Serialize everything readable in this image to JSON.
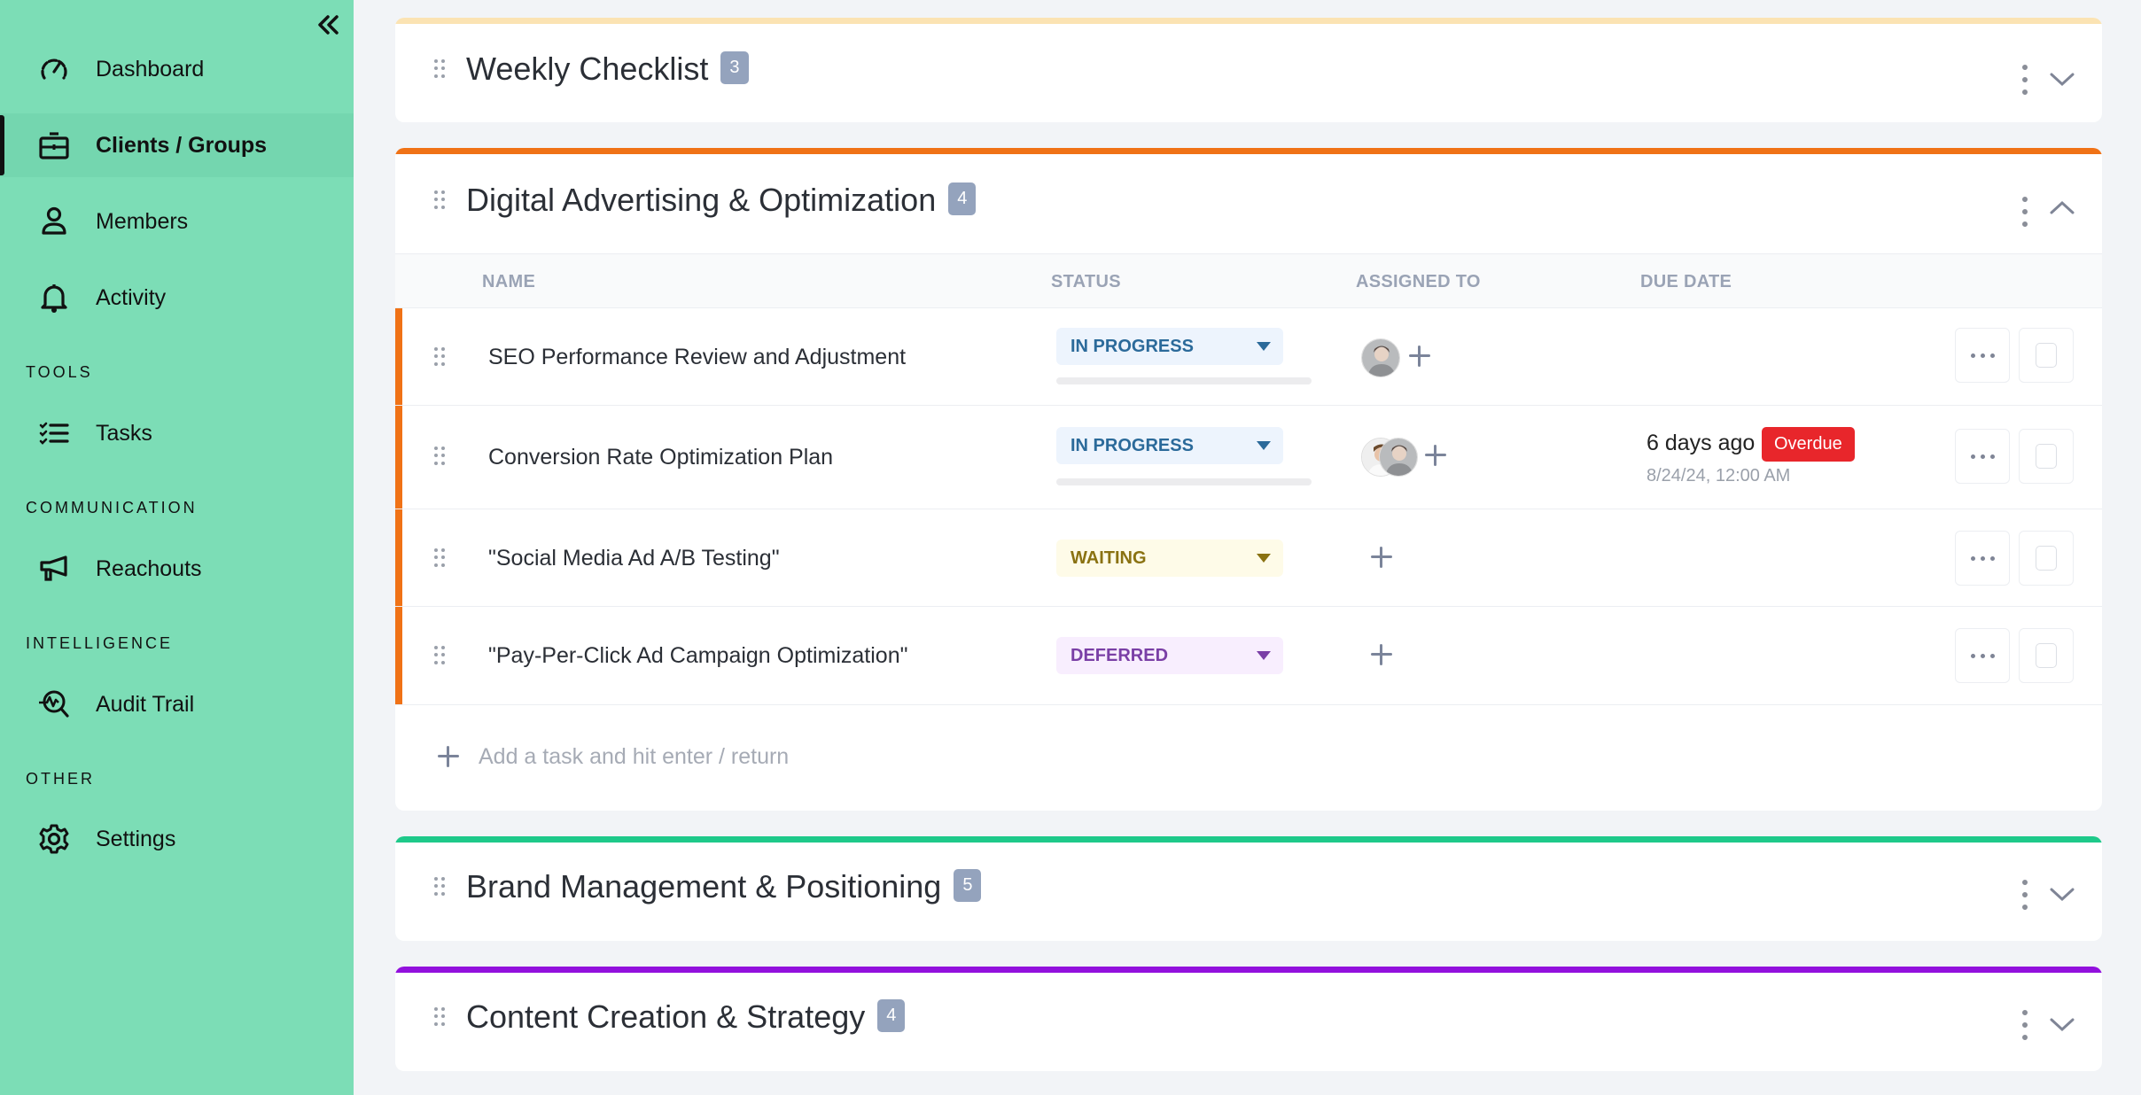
{
  "sidebar": {
    "collapse_label": "Collapse sidebar",
    "items": [
      {
        "label": "Dashboard",
        "icon": "dashboard-gauge-icon",
        "active": false
      },
      {
        "label": "Clients / Groups",
        "icon": "briefcase-icon",
        "active": true
      },
      {
        "label": "Members",
        "icon": "person-icon",
        "active": false
      },
      {
        "label": "Activity",
        "icon": "bell-icon",
        "active": false
      }
    ],
    "sections": [
      {
        "title": "TOOLS",
        "items": [
          {
            "label": "Tasks",
            "icon": "checklist-icon"
          }
        ]
      },
      {
        "title": "COMMUNICATION",
        "items": [
          {
            "label": "Reachouts",
            "icon": "megaphone-icon"
          }
        ]
      },
      {
        "title": "INTELLIGENCE",
        "items": [
          {
            "label": "Audit Trail",
            "icon": "search-activity-icon"
          }
        ]
      },
      {
        "title": "OTHER",
        "items": [
          {
            "label": "Settings",
            "icon": "gear-icon"
          }
        ]
      }
    ]
  },
  "groups": [
    {
      "title": "Weekly Checklist",
      "count": "3",
      "color": "#fbe3b3",
      "expanded": false
    },
    {
      "title": "Digital Advertising & Optimization",
      "count": "4",
      "color": "#f07216",
      "expanded": true,
      "columns": {
        "name": "NAME",
        "status": "STATUS",
        "assigned": "ASSIGNED TO",
        "due": "DUE DATE"
      },
      "tasks": [
        {
          "name": "SEO Performance Review and Adjustment",
          "status": "IN PROGRESS",
          "status_key": "in_progress",
          "assignees": 1,
          "due_relative": "",
          "overdue": "",
          "due_absolute": ""
        },
        {
          "name": "Conversion Rate Optimization Plan",
          "status": "IN PROGRESS",
          "status_key": "in_progress",
          "assignees": 2,
          "due_relative": "6 days ago",
          "overdue": "Overdue",
          "due_absolute": "8/24/24, 12:00 AM"
        },
        {
          "name": "\"Social Media Ad A/B Testing\"",
          "status": "WAITING",
          "status_key": "waiting",
          "assignees": 0,
          "due_relative": "",
          "overdue": "",
          "due_absolute": ""
        },
        {
          "name": "\"Pay-Per-Click Ad Campaign Optimization\"",
          "status": "DEFERRED",
          "status_key": "deferred",
          "assignees": 0,
          "due_relative": "",
          "overdue": "",
          "due_absolute": ""
        }
      ],
      "add_task_placeholder": "Add a task and hit enter / return"
    },
    {
      "title": "Brand Management & Positioning",
      "count": "5",
      "color": "#1ec98a",
      "expanded": false
    },
    {
      "title": "Content Creation & Strategy",
      "count": "4",
      "color": "#9210dd",
      "expanded": false
    }
  ],
  "status_colors": {
    "in_progress": {
      "bg": "#edf4fd",
      "fg": "#2b6a9a"
    },
    "waiting": {
      "bg": "#fefbe8",
      "fg": "#8a7212"
    },
    "deferred": {
      "bg": "#f8eefe",
      "fg": "#7a3fa6"
    }
  },
  "colors": {
    "sidebar_bg": "#7cddb6",
    "overdue": "#e8262b",
    "badge": "#94a3bd"
  }
}
